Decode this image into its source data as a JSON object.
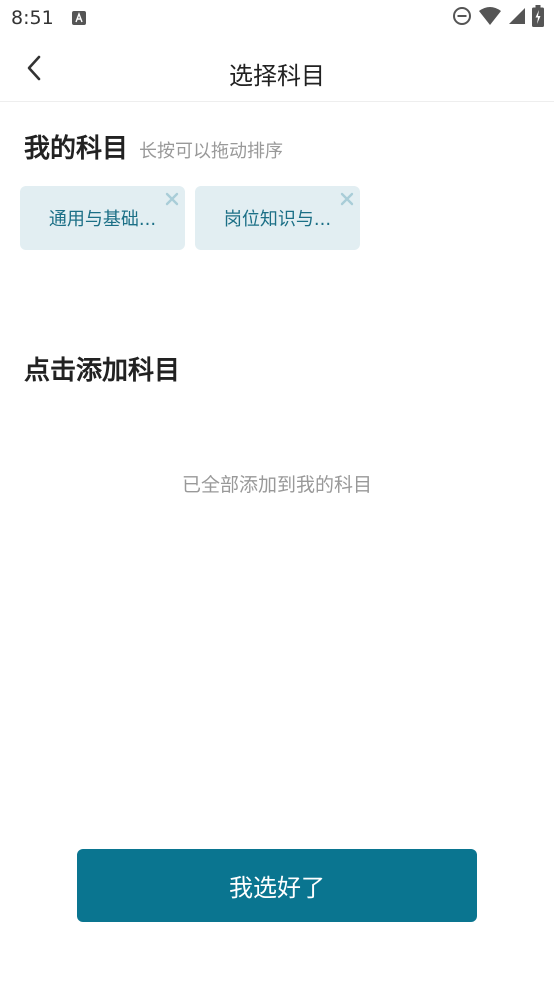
{
  "status_bar": {
    "time": "8:51",
    "icons": [
      "notification-a-icon",
      "do-not-disturb-icon",
      "wifi-icon",
      "signal-icon",
      "battery-icon"
    ]
  },
  "header": {
    "back_icon": "chevron-left-icon",
    "title": "选择科目"
  },
  "my_subjects": {
    "title": "我的科目",
    "hint": "长按可以拖动排序",
    "items": [
      {
        "label": "通用与基础..."
      },
      {
        "label": "岗位知识与..."
      }
    ]
  },
  "add_subjects": {
    "title": "点击添加科目",
    "empty_text": "已全部添加到我的科目"
  },
  "footer": {
    "confirm_label": "我选好了"
  },
  "colors": {
    "accent": "#0a7590",
    "chip_bg": "#e2eef2",
    "chip_text": "#1b6f86",
    "hint_text": "#999999"
  }
}
